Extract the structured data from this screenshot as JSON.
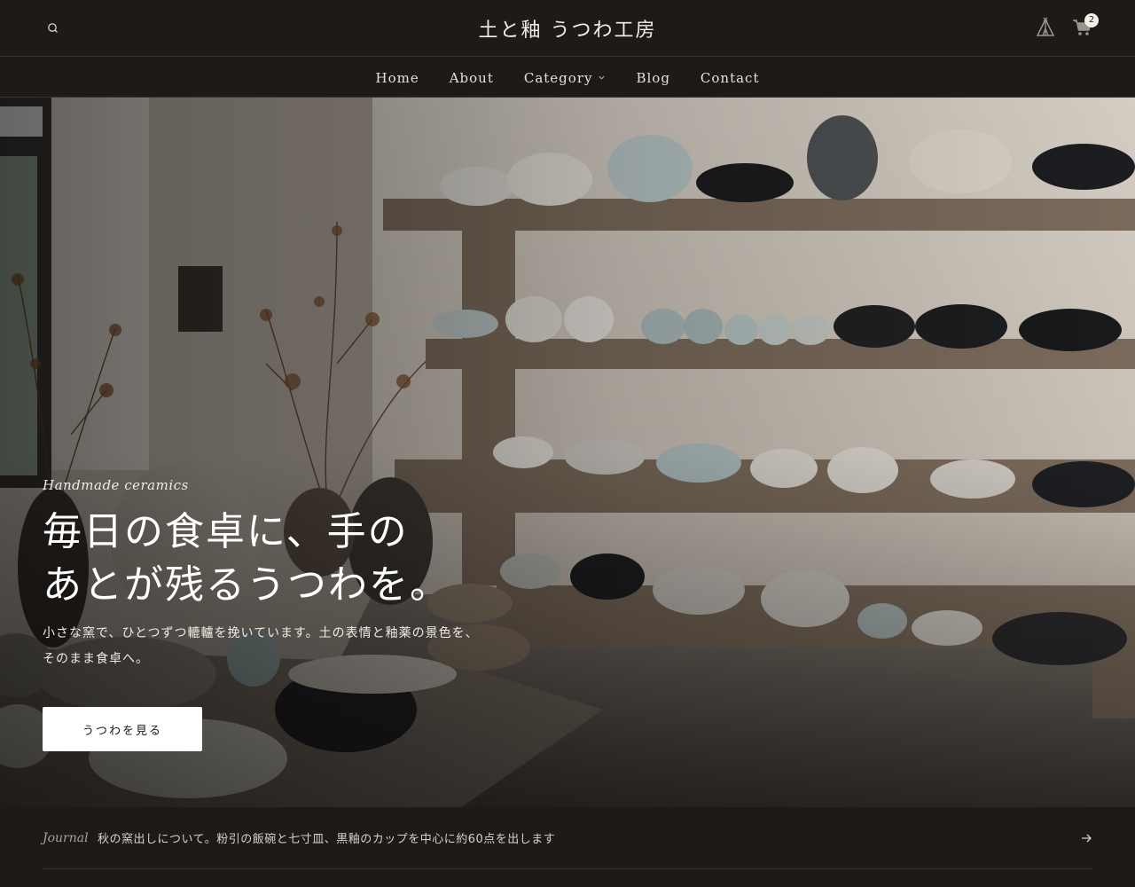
{
  "header": {
    "logo": "土と釉 うつわ工房",
    "cart_count": "2",
    "icons": [
      "search-icon",
      "tent-icon",
      "cart-icon"
    ]
  },
  "nav": {
    "items": [
      {
        "label": "Home"
      },
      {
        "label": "About"
      },
      {
        "label": "Category",
        "has_dropdown": true
      },
      {
        "label": "Blog"
      },
      {
        "label": "Contact"
      }
    ]
  },
  "hero": {
    "eyebrow": "Handmade ceramics",
    "headline_line1": "毎日の食卓に、手の",
    "headline_line2": "あとが残るうつわを。",
    "sub_line1": "小さな窯で、ひとつずつ轆轤を挽いています。土の表情と釉薬の景色を、",
    "sub_line2": "そのまま食卓へ。",
    "cta_label": "うつわを見る"
  },
  "journal": {
    "label": "Journal",
    "text": "秋の窯出しについて。粉引の飯碗と七寸皿、黒釉のカップを中心に約60点を出します"
  },
  "colors": {
    "background": "#1f1a17",
    "divider": "#3a3430",
    "text": "#efe9e2",
    "button_bg": "#ffffff"
  }
}
